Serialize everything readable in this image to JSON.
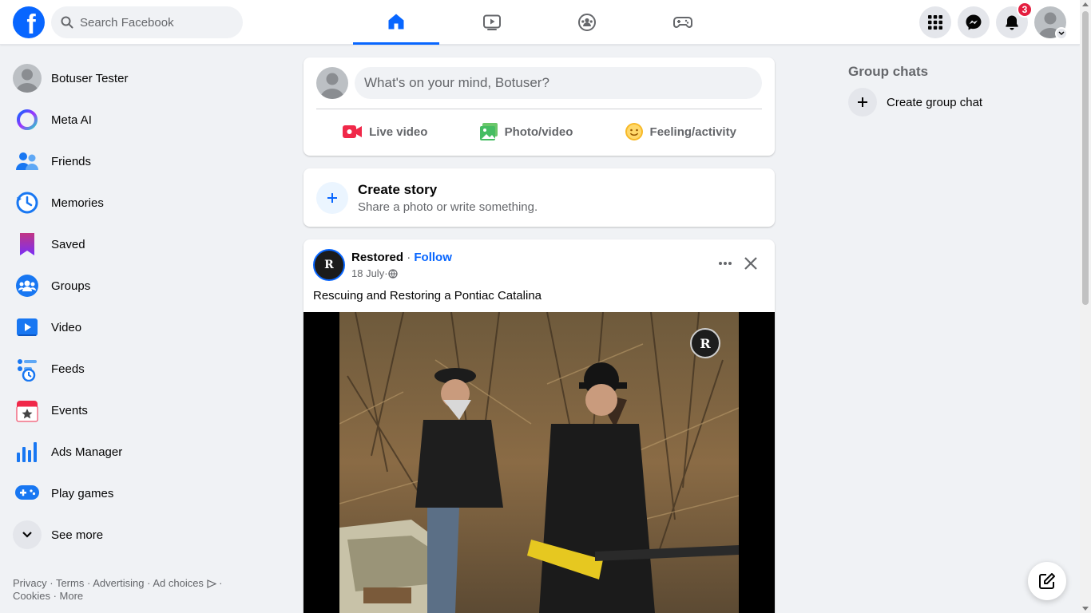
{
  "search": {
    "placeholder": "Search Facebook"
  },
  "nav": {
    "tabs": [
      {
        "name": "home-icon",
        "active": true
      },
      {
        "name": "video-icon",
        "active": false
      },
      {
        "name": "groups-icon",
        "active": false
      },
      {
        "name": "gaming-icon",
        "active": false
      }
    ]
  },
  "header_right": {
    "notifications_count": "3"
  },
  "sidebar": {
    "items": [
      {
        "label": "Botuser Tester",
        "icon": "avatar"
      },
      {
        "label": "Meta AI",
        "icon": "meta-ai-icon"
      },
      {
        "label": "Friends",
        "icon": "friends-icon"
      },
      {
        "label": "Memories",
        "icon": "memories-icon"
      },
      {
        "label": "Saved",
        "icon": "saved-icon"
      },
      {
        "label": "Groups",
        "icon": "groups-icon"
      },
      {
        "label": "Video",
        "icon": "video-icon"
      },
      {
        "label": "Feeds",
        "icon": "feeds-icon"
      },
      {
        "label": "Events",
        "icon": "events-icon"
      },
      {
        "label": "Ads Manager",
        "icon": "ads-manager-icon"
      },
      {
        "label": "Play games",
        "icon": "play-games-icon"
      },
      {
        "label": "See more",
        "icon": "chevron-down-icon"
      }
    ]
  },
  "footer": {
    "privacy": "Privacy",
    "terms": "Terms",
    "advertising": "Advertising",
    "ad_choices": "Ad choices",
    "cookies": "Cookies",
    "more": "More",
    "sep": " · "
  },
  "composer": {
    "prompt": "What's on your mind, Botuser?",
    "live_video": "Live video",
    "photo_video": "Photo/video",
    "feeling": "Feeling/activity"
  },
  "story": {
    "title": "Create story",
    "subtitle": "Share a photo or write something."
  },
  "post": {
    "author": "Restored",
    "sep": " · ",
    "follow": "Follow",
    "date": "18 July",
    "date_sep": " · ",
    "text": "Rescuing and Restoring a Pontiac Catalina"
  },
  "right": {
    "heading": "Group chats",
    "create_group_chat": "Create group chat"
  },
  "colors": {
    "accent": "#0866ff",
    "background": "#f0f2f5",
    "badge": "#e41e3f"
  }
}
